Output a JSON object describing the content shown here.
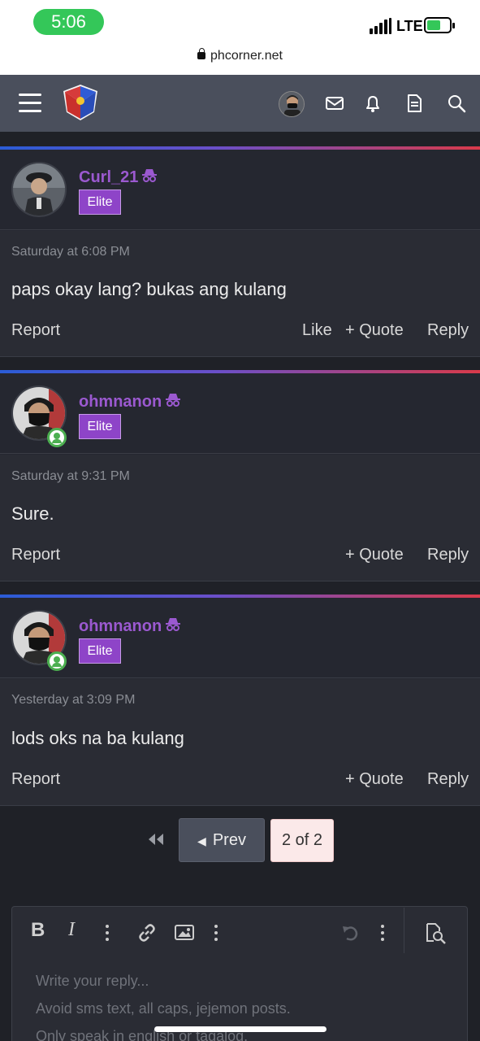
{
  "status_bar": {
    "time": "5:06",
    "network": "LTE"
  },
  "browser": {
    "url": "phcorner.net"
  },
  "colors": {
    "accent_purple": "#9b59d0",
    "badge": "#8e44c8",
    "online": "#4caf50",
    "page_bg": "#1f2127"
  },
  "nav": {
    "icons": [
      "menu-icon",
      "site-logo",
      "user-avatar",
      "mail-icon",
      "bell-icon",
      "document-icon",
      "search-icon"
    ]
  },
  "posts": [
    {
      "username": "Curl_21",
      "badge": "Elite",
      "timestamp": "Saturday at 6:08 PM",
      "message": "paps okay lang? bukas ang kulang",
      "actions": {
        "report": "Report",
        "like": "Like",
        "quote": "+ Quote",
        "reply": "Reply"
      },
      "online": false
    },
    {
      "username": "ohmnanon",
      "badge": "Elite",
      "timestamp": "Saturday at 9:31 PM",
      "message": "Sure.",
      "actions": {
        "report": "Report",
        "quote": "+ Quote",
        "reply": "Reply"
      },
      "online": true
    },
    {
      "username": "ohmnanon",
      "badge": "Elite",
      "timestamp": "Yesterday at 3:09 PM",
      "message": "lods oks na ba kulang",
      "actions": {
        "report": "Report",
        "quote": "+ Quote",
        "reply": "Reply"
      },
      "online": true
    }
  ],
  "pagination": {
    "prev": "Prev",
    "current": "2 of 2"
  },
  "editor": {
    "toolbar": {
      "bold": "B",
      "italic": "I"
    },
    "placeholder_lines": [
      "Write your reply...",
      "Avoid sms text, all caps, jejemon posts.",
      "Only speak in english or tagalog."
    ]
  }
}
